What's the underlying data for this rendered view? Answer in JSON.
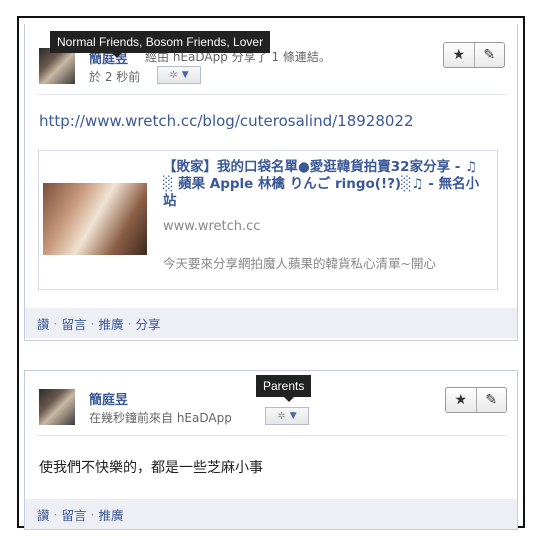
{
  "post1": {
    "name": "簡庭昱",
    "shared_text": "經由 hEaDApp 分享了 1 條連結。",
    "time": "於 2 秒前",
    "tooltip": "Normal Friends, Bosom Friends, Lover",
    "link_url": "http://www.wretch.cc/blog/cuterosalind/18928022",
    "attachment": {
      "title": "【敗家】我的口袋名單●愛逛韓貨拍賣32家分享 - ♫ ░ 蘋果 Apple 林檎 りんご ringo(!?)░♫ - 無名小站",
      "domain": "www.wretch.cc",
      "description": "今天要來分享網拍魔人蘋果的韓貨私心清單~開心"
    },
    "footer": [
      "讚",
      "留言",
      "推廣",
      "分享"
    ]
  },
  "post2": {
    "name": "簡庭昱",
    "time": "在幾秒鐘前來自 hEaDApp",
    "tooltip": "Parents",
    "message": "使我們不快樂的，都是一些芝麻小事",
    "footer": [
      "讚",
      "留言",
      "推廣"
    ]
  },
  "icons": {
    "star": "★",
    "pencil": "✎",
    "gear": "✲",
    "caret": "▼"
  }
}
